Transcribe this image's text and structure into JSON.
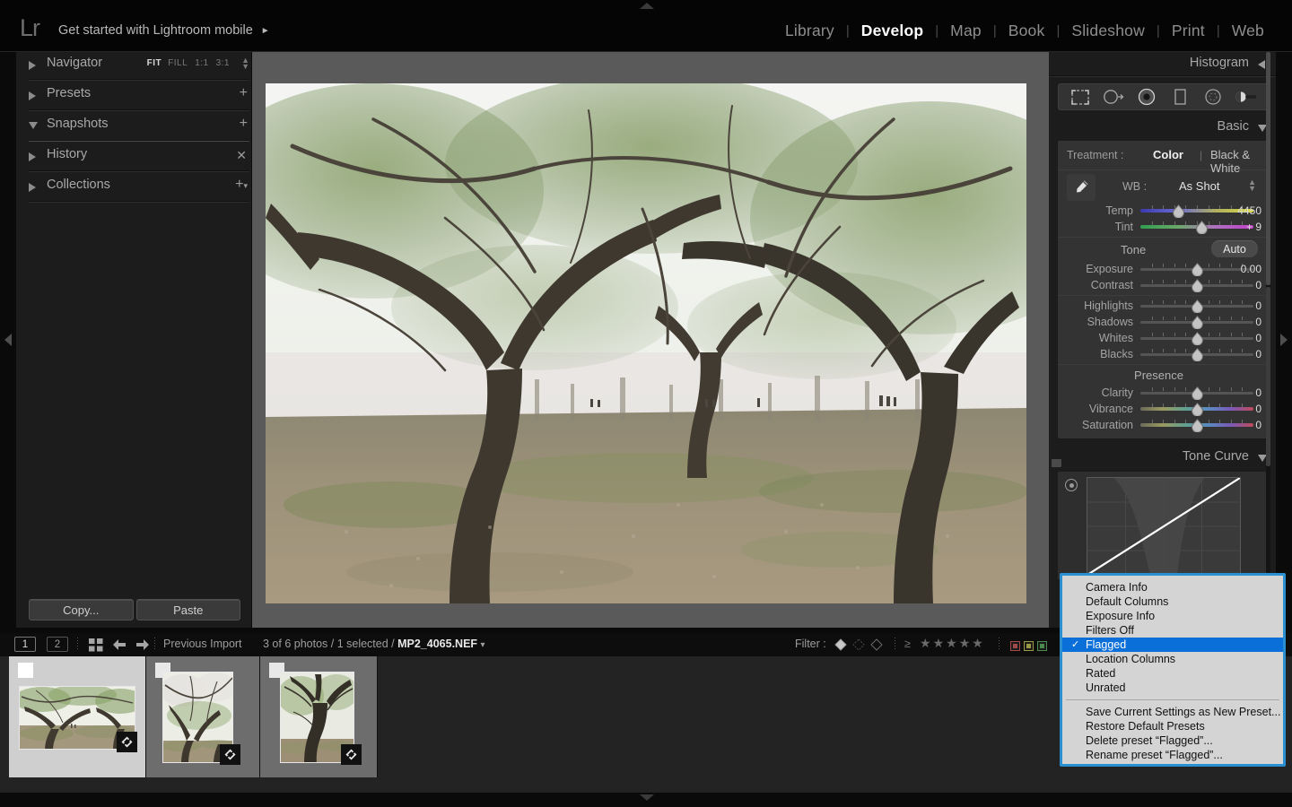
{
  "app": {
    "logo": "Lr",
    "promo": "Get started with Lightroom mobile",
    "promo_arrow": "►"
  },
  "modules": [
    {
      "label": "Library",
      "active": false
    },
    {
      "label": "Develop",
      "active": true
    },
    {
      "label": "Map",
      "active": false
    },
    {
      "label": "Book",
      "active": false
    },
    {
      "label": "Slideshow",
      "active": false
    },
    {
      "label": "Print",
      "active": false
    },
    {
      "label": "Web",
      "active": false
    }
  ],
  "left_panel": {
    "sections": [
      {
        "label": "Navigator",
        "expanded": false
      },
      {
        "label": "Presets",
        "expanded": false
      },
      {
        "label": "Snapshots",
        "expanded": true
      },
      {
        "label": "History",
        "expanded": false
      },
      {
        "label": "Collections",
        "expanded": false
      }
    ],
    "navigator_zoom": {
      "fit": "FIT",
      "fill": "FILL",
      "one": "1:1",
      "three": "3:1"
    },
    "copy_label": "Copy...",
    "paste_label": "Paste"
  },
  "right_panel": {
    "histogram_title": "Histogram",
    "basic_title": "Basic",
    "tone_curve_title": "Tone Curve",
    "tools": [
      "crop-overlay-icon",
      "spot-removal-icon",
      "red-eye-correction-icon",
      "graduated-filter-icon",
      "radial-filter-icon",
      "adjustment-brush-icon"
    ],
    "treatment": {
      "label": "Treatment :",
      "color": "Color",
      "bw": "Black & White",
      "selected": "Color"
    },
    "white_balance": {
      "label": "WB :",
      "value": "As Shot",
      "sliders": [
        {
          "name": "Temp",
          "value": "4450",
          "pos": 33,
          "grad": "temp"
        },
        {
          "name": "Tint",
          "value": "+ 9",
          "pos": 54,
          "grad": "tint"
        }
      ]
    },
    "tone": {
      "label": "Tone",
      "auto_label": "Auto",
      "sliders": [
        {
          "name": "Exposure",
          "value": "0.00",
          "pos": 50,
          "grad": "none"
        },
        {
          "name": "Contrast",
          "value": "0",
          "pos": 50,
          "grad": "none"
        },
        {
          "name": "Highlights",
          "value": "0",
          "pos": 50,
          "grad": "none"
        },
        {
          "name": "Shadows",
          "value": "0",
          "pos": 50,
          "grad": "none"
        },
        {
          "name": "Whites",
          "value": "0",
          "pos": 50,
          "grad": "none"
        },
        {
          "name": "Blacks",
          "value": "0",
          "pos": 50,
          "grad": "none"
        }
      ]
    },
    "presence": {
      "label": "Presence",
      "sliders": [
        {
          "name": "Clarity",
          "value": "0",
          "pos": 50,
          "grad": "none"
        },
        {
          "name": "Vibrance",
          "value": "0",
          "pos": 50,
          "grad": "color"
        },
        {
          "name": "Saturation",
          "value": "0",
          "pos": 50,
          "grad": "color"
        }
      ]
    }
  },
  "context_menu": {
    "items": [
      {
        "label": "Camera Info",
        "checked": false,
        "selected": false
      },
      {
        "label": "Default Columns",
        "checked": false,
        "selected": false
      },
      {
        "label": "Exposure Info",
        "checked": false,
        "selected": false
      },
      {
        "label": "Filters Off",
        "checked": false,
        "selected": false
      },
      {
        "label": "Flagged",
        "checked": true,
        "selected": true
      },
      {
        "label": "Location Columns",
        "checked": false,
        "selected": false
      },
      {
        "label": "Rated",
        "checked": false,
        "selected": false
      },
      {
        "label": "Unrated",
        "checked": false,
        "selected": false
      }
    ],
    "actions": [
      {
        "label": "Save Current Settings as New Preset..."
      },
      {
        "label": "Restore Default Presets"
      },
      {
        "label": "Delete preset “Flagged”..."
      },
      {
        "label": "Rename preset “Flagged”..."
      }
    ],
    "checkmark": "✓",
    "accent_color": "#0a6fd8",
    "border_color": "#2a8fd0"
  },
  "filmstrip_bar": {
    "page1": "1",
    "page2": "2",
    "source": "Previous Import",
    "status_prefix": "3 of 6 photos / 1 selected / ",
    "filename": "MP2_4065.NEF",
    "filename_caret": "▾",
    "filter_label": "Filter :",
    "rating_op": "≥",
    "stars": [
      "★",
      "★",
      "★",
      "★",
      "★"
    ],
    "color_labels": [
      "#a04a4a",
      "#9a9a45",
      "#4a8a4a"
    ]
  },
  "filmstrip": {
    "thumbs": [
      {
        "selected": true,
        "kind": "landscape-wide"
      },
      {
        "selected": false,
        "kind": "portrait-blossom"
      },
      {
        "selected": false,
        "kind": "portrait-trunk"
      }
    ]
  }
}
